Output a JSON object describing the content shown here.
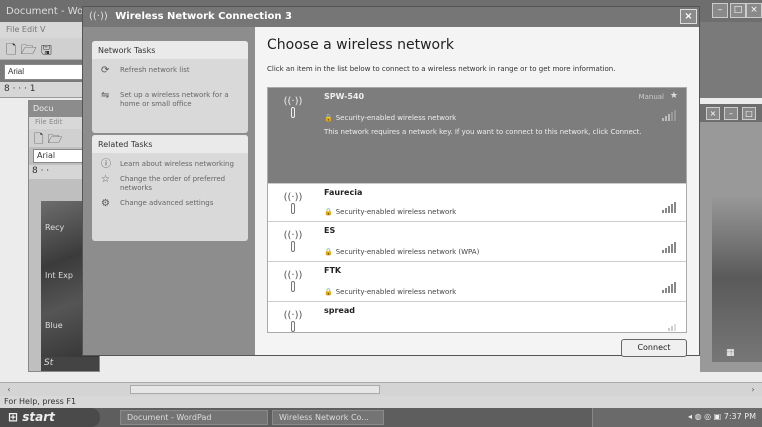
{
  "wordpad": {
    "title": "Document - WordPad",
    "menu": "File  Edit  V",
    "font": "Arial",
    "status": "For Help, press F1"
  },
  "inner_doc": {
    "title": "Docu",
    "menu": "File  Edit",
    "font": "Arial",
    "desktop_labels": [
      "Recy",
      "Int Exp",
      "Blue"
    ],
    "taskbar_text": "St"
  },
  "dialog": {
    "title": "Wireless Network Connection 3",
    "heading": "Choose a wireless network",
    "instruction": "Click an item in the list below to connect to a wireless network in range or to get more information.",
    "connect_label": "Connect"
  },
  "network_tasks": {
    "header": "Network Tasks",
    "items": [
      {
        "label": "Refresh network list",
        "icon": "refresh-icon"
      },
      {
        "label": "Set up a wireless network for a home or small office",
        "icon": "setup-icon"
      }
    ]
  },
  "related_tasks": {
    "header": "Related Tasks",
    "items": [
      {
        "label": "Learn about wireless networking",
        "icon": "info-icon"
      },
      {
        "label": "Change the order of preferred networks",
        "icon": "star-icon"
      },
      {
        "label": "Change advanced settings",
        "icon": "settings-icon"
      }
    ]
  },
  "networks": [
    {
      "name": "SPW-540",
      "security": "Security-enabled wireless network",
      "status": "Manual",
      "selected": true,
      "description": "This network requires a network key. If you want to connect to this network, click Connect.",
      "signal": 3
    },
    {
      "name": "Faurecia",
      "security": "Security-enabled wireless network",
      "signal": 4
    },
    {
      "name": "ES",
      "security": "Security-enabled wireless network (WPA)",
      "signal": 4
    },
    {
      "name": "FTK",
      "security": "Security-enabled wireless network",
      "signal": 4
    },
    {
      "name": "spread",
      "security": "",
      "signal": 1
    }
  ],
  "taskbar": {
    "start": "start",
    "buttons": [
      "Document - WordPad",
      "Wireless Network Co..."
    ],
    "clock": "7:37 PM"
  },
  "colors": {
    "selected_row": "#7d7d7d",
    "task_pane": "#8d8d8d"
  }
}
